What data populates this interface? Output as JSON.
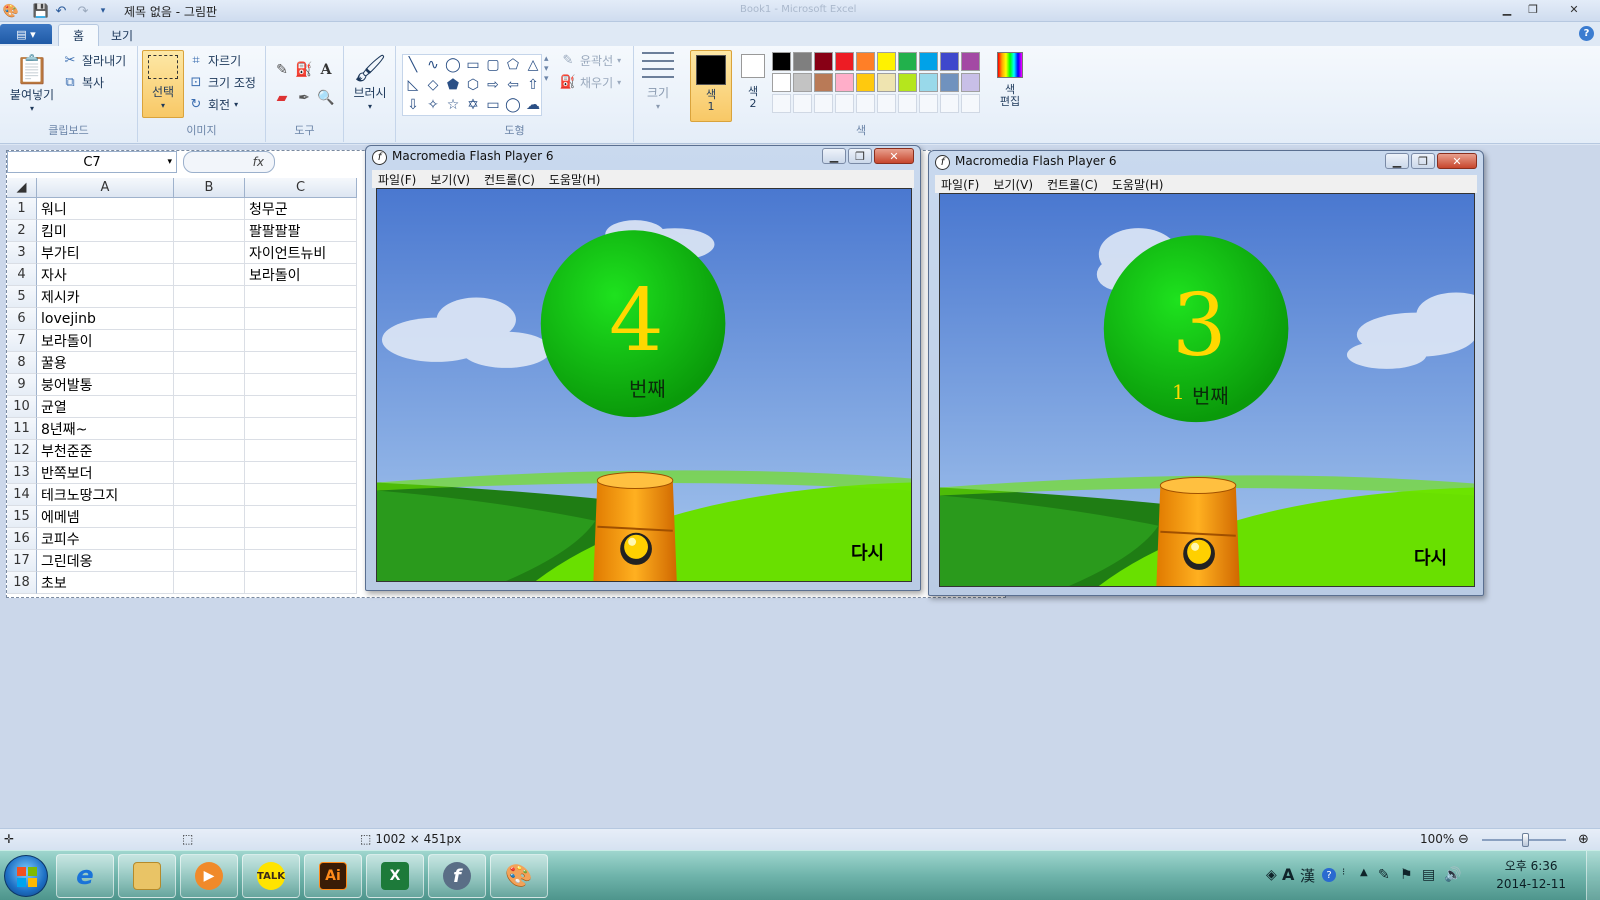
{
  "window": {
    "title": "제목 없음 - 그림판",
    "ghost_title": "Book1 - Microsoft Excel"
  },
  "tabs": [
    {
      "label": "홈",
      "active": true
    },
    {
      "label": "보기",
      "active": false
    }
  ],
  "ribbon": {
    "clipboard": {
      "label": "클립보드",
      "paste": "붙여넣기",
      "cut": "잘라내기",
      "copy": "복사"
    },
    "image": {
      "label": "이미지",
      "select": "선택",
      "crop": "자르기",
      "resize": "크기 조정",
      "rotate": "회전"
    },
    "tools": {
      "label": "도구"
    },
    "brushes": {
      "label": "브러시"
    },
    "shapes": {
      "label": "도형",
      "outline": "윤곽선",
      "fill": "채우기"
    },
    "size": {
      "label": "크기"
    },
    "colors": {
      "label": "색",
      "color1": "색\n1",
      "color2": "색\n2",
      "edit": "색\n편집",
      "color1_value": "#000000",
      "color2_value": "#ffffff",
      "palette_row1": [
        "#000000",
        "#7f7f7f",
        "#880015",
        "#ed1c24",
        "#ff7f27",
        "#fff200",
        "#22b14c",
        "#00a2e8",
        "#3f48cc",
        "#a349a4"
      ],
      "palette_row2": [
        "#ffffff",
        "#c3c3c3",
        "#b97a57",
        "#ffaec9",
        "#ffc90e",
        "#efe4b0",
        "#b5e61d",
        "#99d9ea",
        "#7092be",
        "#c8bfe7"
      ]
    }
  },
  "sheet": {
    "name_box": "C7",
    "fx": "fx",
    "columns": [
      "A",
      "B",
      "C"
    ],
    "rows": [
      {
        "n": "1",
        "a": "워니",
        "b": "",
        "c": "청무군"
      },
      {
        "n": "2",
        "a": "킴미",
        "b": "",
        "c": "팔팔팔팔"
      },
      {
        "n": "3",
        "a": "부가티",
        "b": "",
        "c": "자이언트뉴비"
      },
      {
        "n": "4",
        "a": "자사",
        "b": "",
        "c": "보라돌이"
      },
      {
        "n": "5",
        "a": "제시카",
        "b": "",
        "c": ""
      },
      {
        "n": "6",
        "a": "lovejinb",
        "b": "",
        "c": ""
      },
      {
        "n": "7",
        "a": "보라돌이",
        "b": "",
        "c": ""
      },
      {
        "n": "8",
        "a": "꿀용",
        "b": "",
        "c": ""
      },
      {
        "n": "9",
        "a": "붕어발통",
        "b": "",
        "c": ""
      },
      {
        "n": "10",
        "a": "균열",
        "b": "",
        "c": ""
      },
      {
        "n": "11",
        "a": "8년째~",
        "b": "",
        "c": ""
      },
      {
        "n": "12",
        "a": "부천준준",
        "b": "",
        "c": ""
      },
      {
        "n": "13",
        "a": "반쪽보더",
        "b": "",
        "c": ""
      },
      {
        "n": "14",
        "a": "테크노땅그지",
        "b": "",
        "c": ""
      },
      {
        "n": "15",
        "a": "에메넴",
        "b": "",
        "c": ""
      },
      {
        "n": "16",
        "a": "코피수",
        "b": "",
        "c": ""
      },
      {
        "n": "17",
        "a": "그린데옹",
        "b": "",
        "c": ""
      },
      {
        "n": "18",
        "a": "초보",
        "b": "",
        "c": ""
      }
    ]
  },
  "flash1": {
    "title": "Macromedia Flash Player 6",
    "menu": [
      "파일(F)",
      "보기(V)",
      "컨트롤(C)",
      "도움말(H)"
    ],
    "ball_number": "4",
    "ball_prefix": "",
    "ball_label": "번째",
    "again": "다시"
  },
  "flash2": {
    "title": "Macromedia Flash Player 6",
    "menu": [
      "파일(F)",
      "보기(V)",
      "컨트롤(C)",
      "도움말(H)"
    ],
    "ball_number": "3",
    "ball_prefix": "1",
    "ball_label": "번째",
    "again": "다시"
  },
  "status": {
    "dimensions": "1002 × 451px",
    "zoom": "100%"
  },
  "taskbar": {
    "apps": [
      "explorer-ie",
      "file-explorer",
      "media-player",
      "kakaotalk",
      "illustrator",
      "excel",
      "flash",
      "paint"
    ],
    "kakao_label": "TALK",
    "ai_label": "Ai",
    "ime_a": "A",
    "ime_han": "漢",
    "clock_time": "오후 6:36",
    "clock_date": "2014-12-11"
  }
}
